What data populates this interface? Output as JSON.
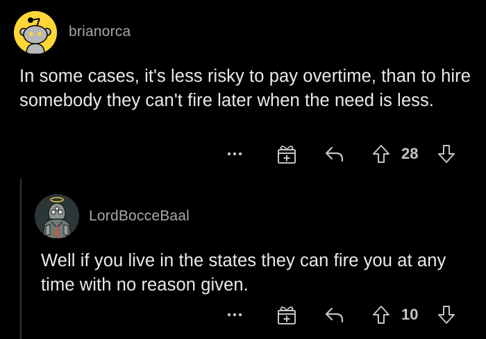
{
  "comments": [
    {
      "username": "brianorca",
      "body": "In some cases, it's less risky to pay overtime, than to hire somebody they can't fire later when the need is less.",
      "score": "28",
      "avatar_icon": "snoo-avatar-icon"
    },
    {
      "username": "LordBocceBaal",
      "body": "Well if you live in the states they can fire you at any time with no reason given.",
      "score": "10",
      "avatar_icon": "custom-avatar-icon"
    }
  ],
  "actions": {
    "more_icon": "more-options-icon",
    "award_icon": "award-gift-icon",
    "reply_icon": "reply-arrow-icon",
    "upvote_icon": "upvote-arrow-icon",
    "downvote_icon": "downvote-arrow-icon"
  },
  "colors": {
    "background": "#000000",
    "username": "#a5a8ab",
    "body_text": "#e8eaeb",
    "icon": "#c3c6c9",
    "thread_line": "#343536",
    "snoo_bg": "#ffd635"
  }
}
